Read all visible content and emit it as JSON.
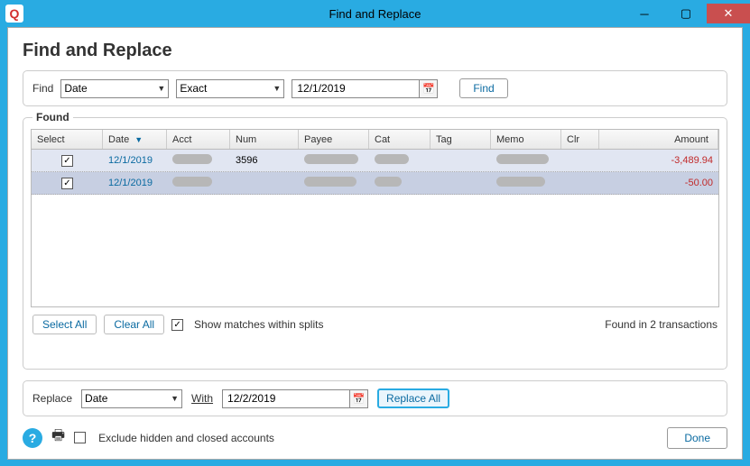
{
  "window": {
    "title": "Find and Replace",
    "heading": "Find and Replace"
  },
  "find": {
    "label": "Find",
    "field_select": "Date",
    "match_select": "Exact",
    "value": "12/1/2019",
    "button": "Find"
  },
  "found": {
    "label": "Found",
    "columns": {
      "select": "Select",
      "date": "Date",
      "acct": "Acct",
      "num": "Num",
      "payee": "Payee",
      "cat": "Cat",
      "tag": "Tag",
      "memo": "Memo",
      "clr": "Clr",
      "amount": "Amount"
    },
    "rows": [
      {
        "checked": true,
        "date": "12/1/2019",
        "num": "3596",
        "amount": "-3,489.94"
      },
      {
        "checked": true,
        "date": "12/1/2019",
        "num": "",
        "amount": "-50.00"
      }
    ],
    "select_all": "Select All",
    "clear_all": "Clear All",
    "show_splits_checked": true,
    "show_splits_label": "Show matches within splits",
    "count_text": "Found in 2 transactions"
  },
  "replace": {
    "label": "Replace",
    "field_select": "Date",
    "with_label": "With",
    "value": "12/2/2019",
    "button": "Replace All"
  },
  "footer": {
    "exclude_label": "Exclude hidden and closed accounts",
    "exclude_checked": false,
    "done": "Done"
  }
}
